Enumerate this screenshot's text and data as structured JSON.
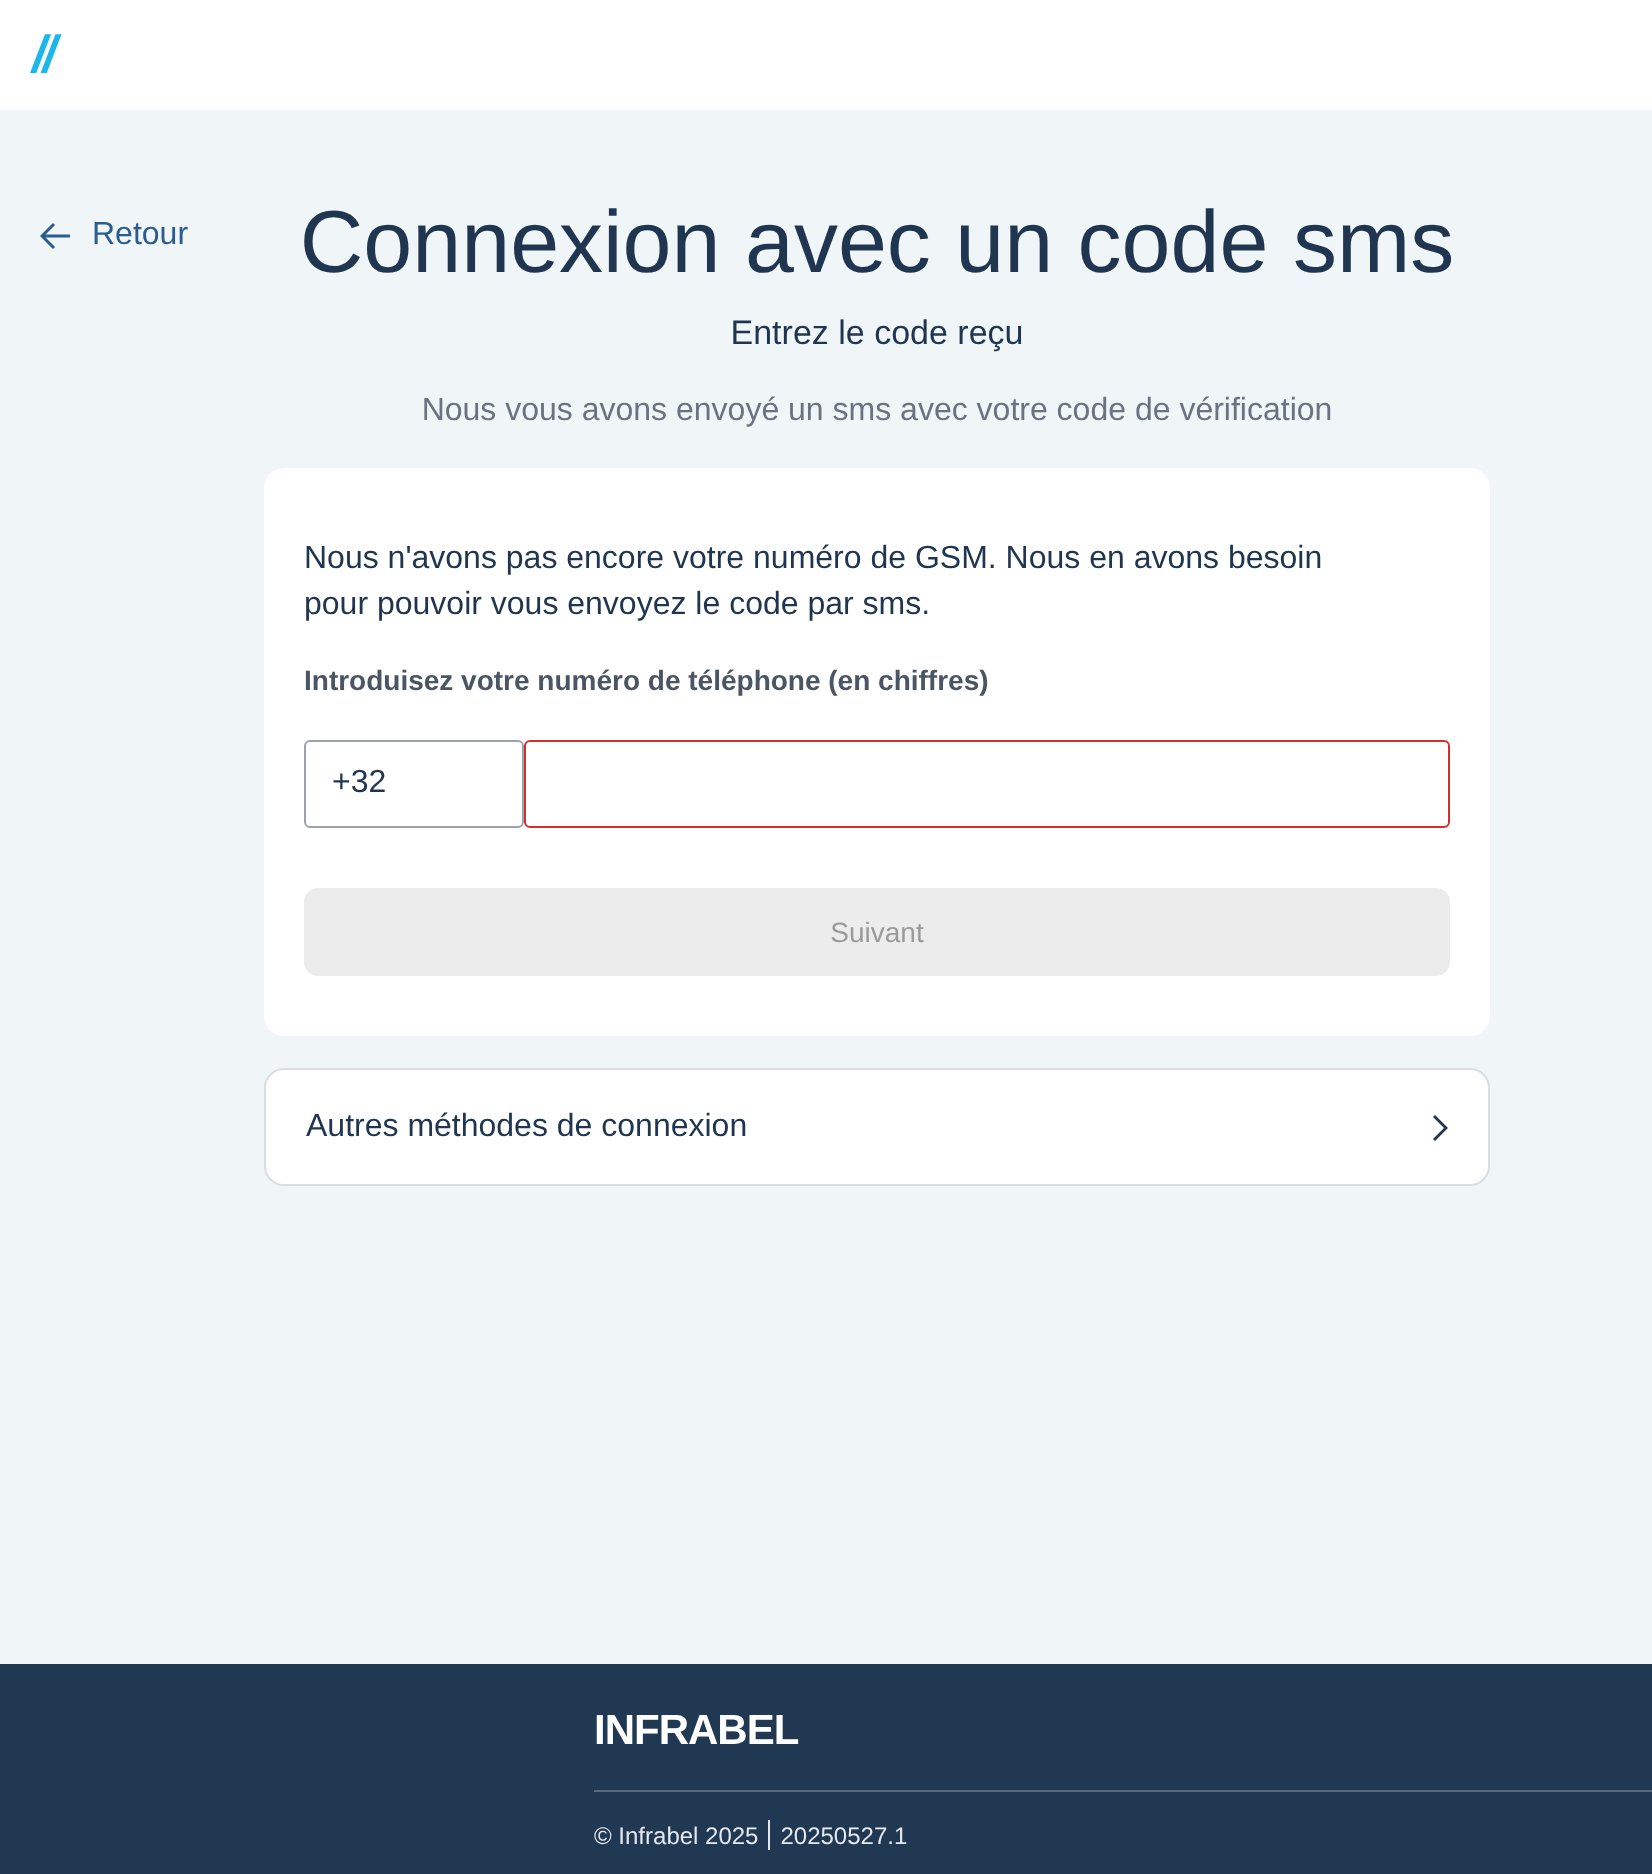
{
  "header": {
    "logo": "//"
  },
  "back_link": {
    "label": "Retour"
  },
  "title": "Connexion avec un code sms",
  "subtitle": "Entrez le code reçu",
  "description": "Nous vous avons envoyé un sms avec votre code de vérification",
  "form": {
    "message": "Nous n'avons pas encore votre numéro de GSM. Nous en avons besoin pour pouvoir vous envoyez le code par sms.",
    "phone_label": "Introduisez votre numéro de téléphone (en chiffres)",
    "country_code": "+32",
    "phone": {
      "invalid": true
    },
    "submit": {
      "label": "Suivant",
      "disabled": true
    }
  },
  "other_methods": {
    "label": "Autres méthodes de connexion"
  },
  "footer": {
    "logo": "INFRABEL",
    "copyright": "© Infrabel 2025",
    "version": "20250527.1"
  }
}
